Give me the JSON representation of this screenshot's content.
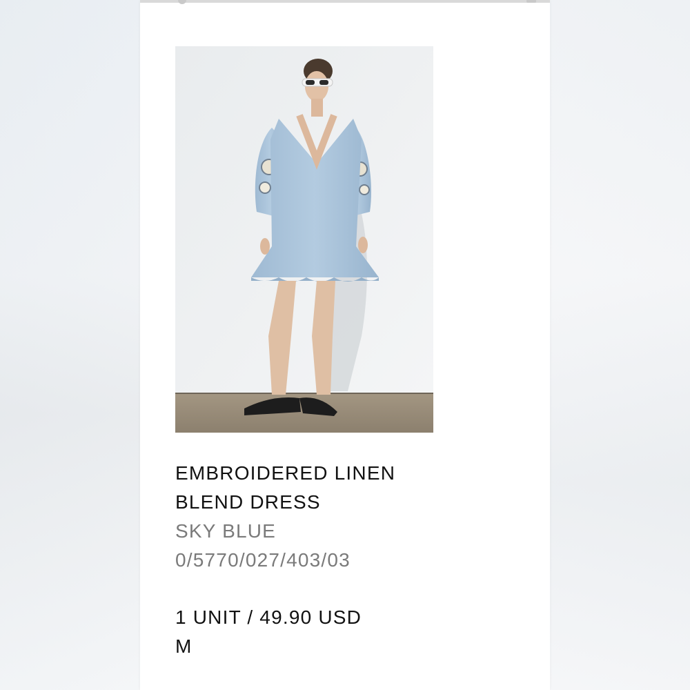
{
  "product": {
    "image_icon": "product-photo",
    "name": "EMBROIDERED LINEN BLEND DRESS",
    "color": "SKY BLUE",
    "reference": "0/5770/027/403/03"
  },
  "order": {
    "quantity_price": "1 UNIT / 49.90 USD",
    "size": "M"
  },
  "colors": {
    "primary_text": "#111111",
    "secondary_text": "#7a7a7a",
    "dress": "#a9c4dc"
  }
}
